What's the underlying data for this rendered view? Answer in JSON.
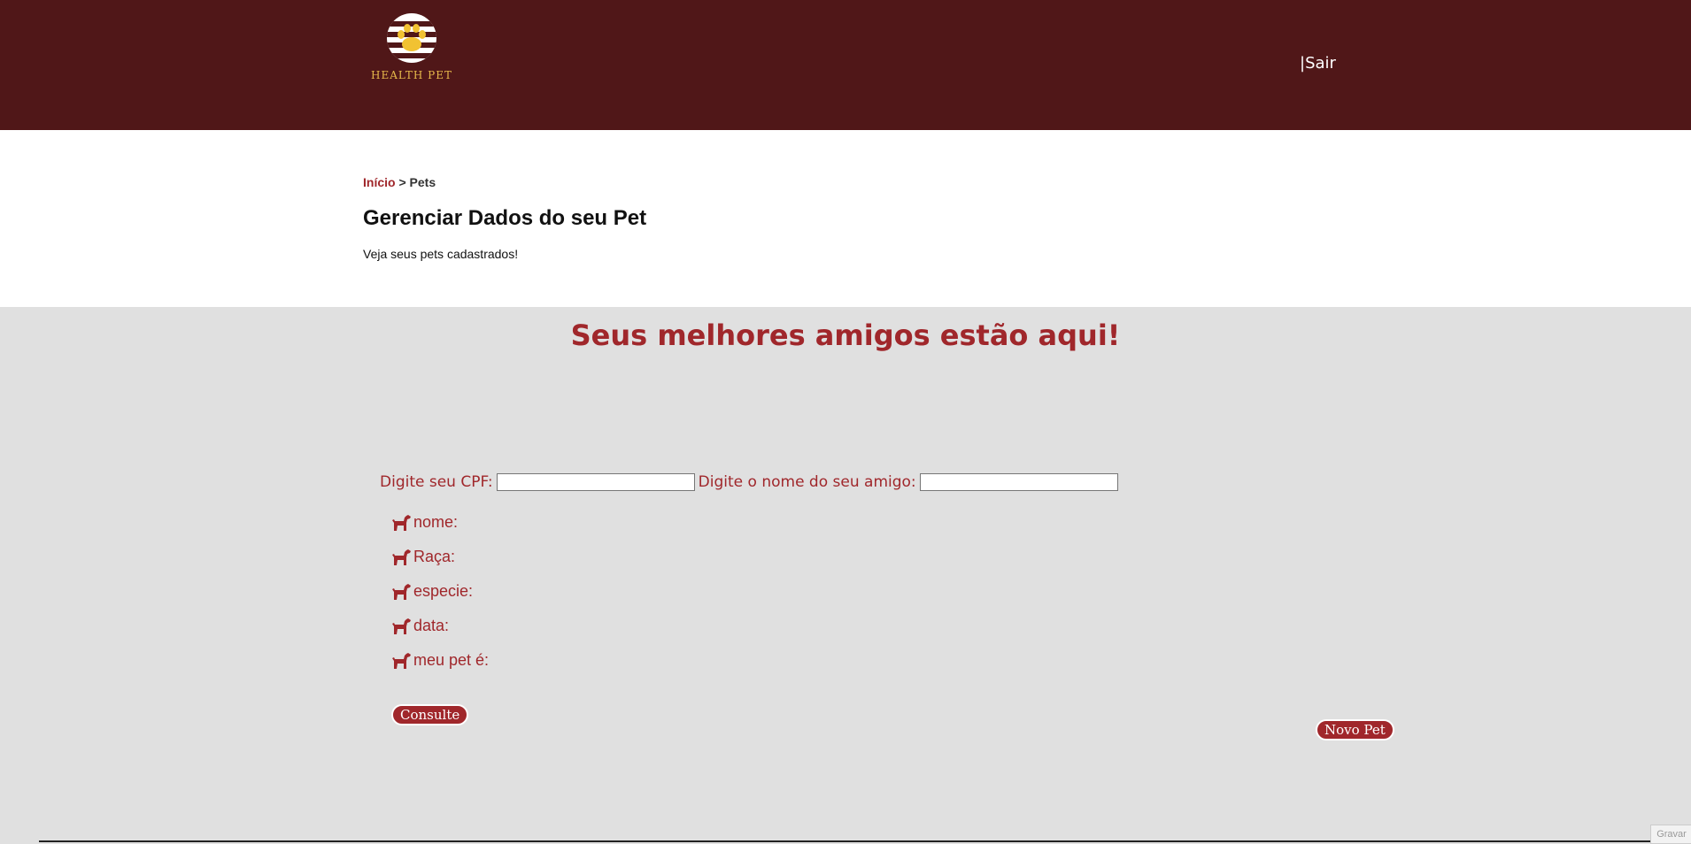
{
  "header": {
    "brand": "HEALTH PET",
    "logout_label": "|Sair"
  },
  "breadcrumb": {
    "home": "Início",
    "separator": " > ",
    "current": "Pets"
  },
  "page": {
    "title": "Gerenciar Dados do seu Pet",
    "subtitle": "Veja seus pets cadastrados!"
  },
  "main": {
    "headline": "Seus melhores amigos estão aqui!",
    "search": {
      "cpf_label": "Digite seu CPF:",
      "cpf_value": "",
      "name_label": "Digite o nome do seu amigo:",
      "name_value": ""
    },
    "fields": [
      {
        "label": " nome:",
        "icon": "dog-icon"
      },
      {
        "label": "Raça:",
        "icon": "dog-icon"
      },
      {
        "label": "especie:",
        "icon": "dog-icon"
      },
      {
        "label": "data:",
        "icon": "dog-icon"
      },
      {
        "label": "meu pet é:",
        "icon": "dog-icon"
      }
    ],
    "consult_button": "Consulte",
    "new_pet_button": "Novo Pet"
  },
  "footer": {
    "record_label": "Gravar"
  },
  "colors": {
    "header_bg": "#501718",
    "accent": "#a0272b",
    "body_bg": "#e0e0e0",
    "brand_gold": "#e6b84a"
  }
}
